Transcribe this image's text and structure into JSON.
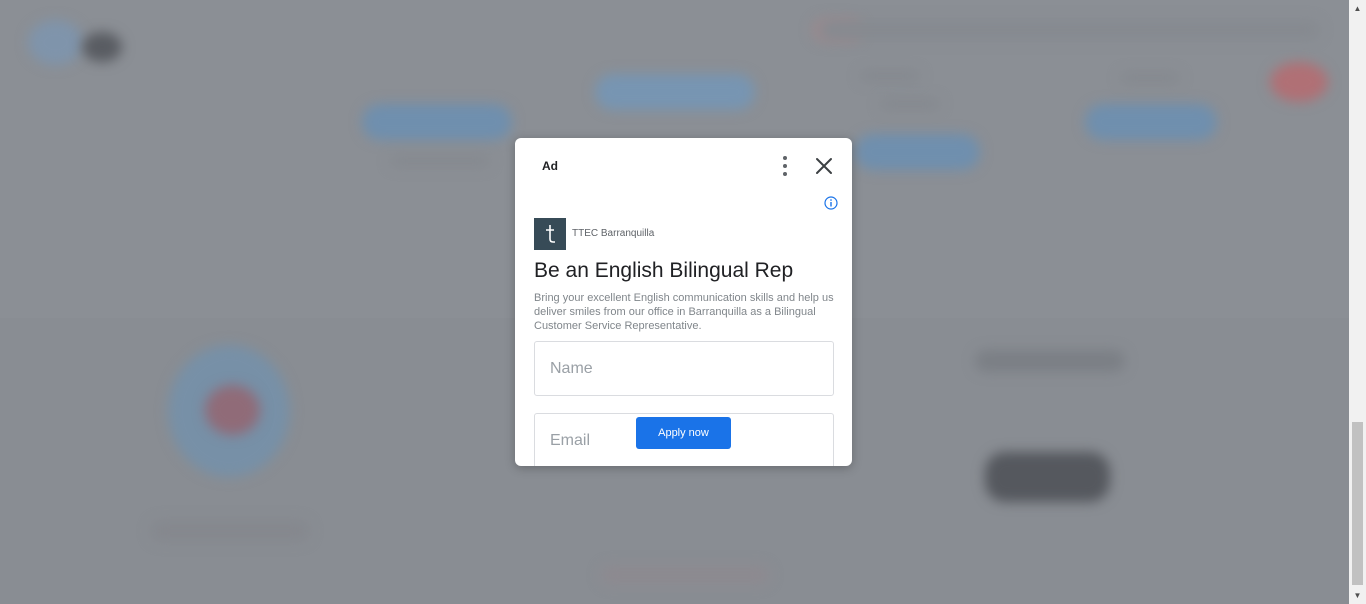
{
  "ad": {
    "label": "Ad",
    "advertiser": "TTEC Barranquilla",
    "headline": "Be an English Bilingual Rep",
    "body": "Bring your excellent English communication skills and help us deliver smiles from our office in Barranquilla as a Bilingual Customer Service Representative.",
    "name_placeholder": "Name",
    "email_placeholder": "Email",
    "cta": "Apply now",
    "logo_glyph": "ţ",
    "icons": {
      "menu": "kebab-menu-icon",
      "close": "close-icon",
      "info": "info-icon"
    },
    "colors": {
      "cta": "#1a73e8",
      "logo_bg": "#374b57",
      "info": "#1a73e8"
    }
  }
}
